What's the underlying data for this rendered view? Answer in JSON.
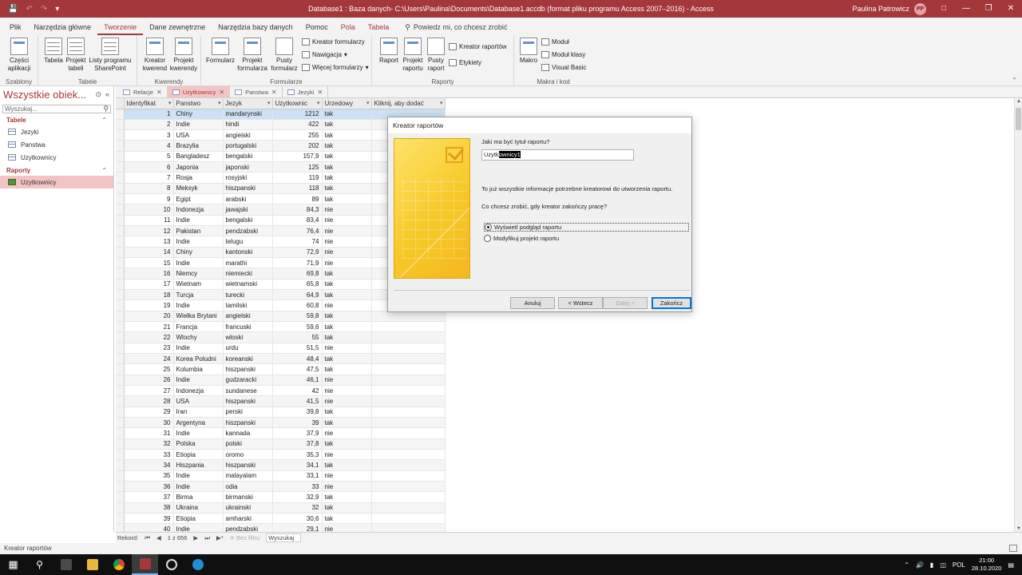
{
  "titlebar": {
    "title": "Database1 : Baza danych- C:\\Users\\Paulina\\Documents\\Database1.accdb (format pliku programu Access 2007–2016)  -  Access",
    "user": "Paulina Patrowicz",
    "initials": "PP"
  },
  "tabs": [
    "Plik",
    "Narzędzia główne",
    "Tworzenie",
    "Dane zewnętrzne",
    "Narzędzia bazy danych",
    "Pomoc",
    "Pola",
    "Tabela"
  ],
  "tellme": "Powiedz mi, co chcesz zrobić",
  "ribbon": {
    "szablony": {
      "label": "Szablony",
      "czesci": "Części aplikacji"
    },
    "tabele": {
      "label": "Tabele",
      "tabela": "Tabela",
      "projekt": "Projekt tabeli",
      "listy": "Listy programu SharePoint"
    },
    "kwerendy": {
      "label": "Kwerendy",
      "kreator": "Kreator kwerend",
      "projekt": "Projekt kwerendy"
    },
    "formularze": {
      "label": "Formularze",
      "formularz": "Formularz",
      "projekt": "Projekt formularza",
      "pusty": "Pusty formularz",
      "kreator": "Kreator formularzy",
      "nawigacja": "Nawigacja",
      "wiecej": "Więcej formularzy"
    },
    "raporty": {
      "label": "Raporty",
      "raport": "Raport",
      "projekt": "Projekt raportu",
      "pusty": "Pusty raport",
      "kreator": "Kreator raportów",
      "etykiety": "Etykiety"
    },
    "makra": {
      "label": "Makra i kod",
      "makro": "Makro",
      "modul": "Moduł",
      "modul_klasy": "Moduł klasy",
      "vb": "Visual Basic"
    }
  },
  "nav": {
    "title": "Wszystkie obiek...",
    "search_placeholder": "Wyszukaj...",
    "groups": [
      {
        "name": "Tabele",
        "items": [
          "Jezyki",
          "Panstwa",
          "Uzytkownicy"
        ]
      },
      {
        "name": "Raporty",
        "items": [
          "Uzytkownicy"
        ]
      }
    ]
  },
  "doctabs": [
    "Relacje",
    "Uzytkownicy",
    "Panstwa",
    "Jezyki"
  ],
  "sheet": {
    "headers": [
      "Identyfikat",
      "Panstwo",
      "Jezyk",
      "Uzytkownic",
      "Urzedowy",
      "Kliknij, aby dodać"
    ],
    "rows": [
      [
        1,
        "Chiny",
        "mandarynski",
        "1212",
        "tak"
      ],
      [
        2,
        "Indie",
        "hindi",
        "422",
        "tak"
      ],
      [
        3,
        "USA",
        "angielski",
        "255",
        "tak"
      ],
      [
        4,
        "Brazylia",
        "portugalski",
        "202",
        "tak"
      ],
      [
        5,
        "Bangladesz",
        "bengalski",
        "157,9",
        "tak"
      ],
      [
        6,
        "Japonia",
        "japonski",
        "125",
        "tak"
      ],
      [
        7,
        "Rosja",
        "rosyjski",
        "119",
        "tak"
      ],
      [
        8,
        "Meksyk",
        "hiszpanski",
        "118",
        "tak"
      ],
      [
        9,
        "Egipt",
        "arabski",
        "89",
        "tak"
      ],
      [
        10,
        "Indonezja",
        "jawajski",
        "84,3",
        "nie"
      ],
      [
        11,
        "Indie",
        "bengalski",
        "83,4",
        "nie"
      ],
      [
        12,
        "Pakistan",
        "pendzabski",
        "76,4",
        "nie"
      ],
      [
        13,
        "Indie",
        "telugu",
        "74",
        "nie"
      ],
      [
        14,
        "Chiny",
        "kantonski",
        "72,9",
        "nie"
      ],
      [
        15,
        "Indie",
        "marathi",
        "71,9",
        "nie"
      ],
      [
        16,
        "Niemcy",
        "niemiecki",
        "69,8",
        "tak"
      ],
      [
        17,
        "Wietnam",
        "wietnamski",
        "65,8",
        "tak"
      ],
      [
        18,
        "Turcja",
        "turecki",
        "64,9",
        "tak"
      ],
      [
        19,
        "Indie",
        "tamilski",
        "60,8",
        "nie"
      ],
      [
        20,
        "Wielka Brytani",
        "angielski",
        "59,8",
        "tak"
      ],
      [
        21,
        "Francja",
        "francuski",
        "59,6",
        "tak"
      ],
      [
        22,
        "Wlochy",
        "wloski",
        "55",
        "tak"
      ],
      [
        23,
        "Indie",
        "urdu",
        "51,5",
        "nie"
      ],
      [
        24,
        "Korea Poludni",
        "koreanski",
        "48,4",
        "tak"
      ],
      [
        25,
        "Kolumbia",
        "hiszpanski",
        "47,5",
        "tak"
      ],
      [
        26,
        "Indie",
        "gudzaracki",
        "46,1",
        "nie"
      ],
      [
        27,
        "Indonezja",
        "sundanese",
        "42",
        "nie"
      ],
      [
        28,
        "USA",
        "hiszpanski",
        "41,5",
        "nie"
      ],
      [
        29,
        "Iran",
        "perski",
        "39,8",
        "tak"
      ],
      [
        30,
        "Argentyna",
        "hiszpanski",
        "39",
        "tak"
      ],
      [
        31,
        "Indie",
        "kannada",
        "37,9",
        "nie"
      ],
      [
        32,
        "Polska",
        "polski",
        "37,8",
        "tak"
      ],
      [
        33,
        "Etiopia",
        "oromo",
        "35,3",
        "nie"
      ],
      [
        34,
        "Hiszpania",
        "hiszpanski",
        "34,1",
        "tak"
      ],
      [
        35,
        "Indie",
        "malayalam",
        "33,1",
        "nie"
      ],
      [
        36,
        "Indie",
        "odia",
        "33",
        "nie"
      ],
      [
        37,
        "Birma",
        "birmanski",
        "32,9",
        "tak"
      ],
      [
        38,
        "Ukraina",
        "ukrainski",
        "32",
        "tak"
      ],
      [
        39,
        "Etiopia",
        "amharski",
        "30,6",
        "tak"
      ],
      [
        40,
        "Indie",
        "pendzabski",
        "29,1",
        "nie"
      ]
    ]
  },
  "recnav": {
    "label": "Rekord:",
    "position": "1 z 656",
    "filter": "Bez filtru",
    "search": "Wyszukaj"
  },
  "status": "Kreator raportów",
  "dialog": {
    "title": "Kreator raportów",
    "q1": "Jaki ma być tytuł raportu?",
    "input_plain": "Uzytk",
    "input_selected": "ownicy1",
    "info": "To już wszystkie informacje potrzebne kreatorowi do utworzenia raportu.",
    "q2": "Co chcesz zrobić, gdy kreator zakończy pracę?",
    "opt1": "Wyświetl podgląd raportu",
    "opt2": "Modyfikuj projekt raportu",
    "cancel": "Anuluj",
    "back": "< Wstecz",
    "next": "Dalej >",
    "finish": "Zakończ"
  },
  "taskbar": {
    "time": "21:00",
    "date": "28.10.2020",
    "lang": "POL"
  },
  "colors": {
    "accent": "#a4373a",
    "selection": "#cce1f5",
    "tab_active": "#f3c4c4"
  }
}
